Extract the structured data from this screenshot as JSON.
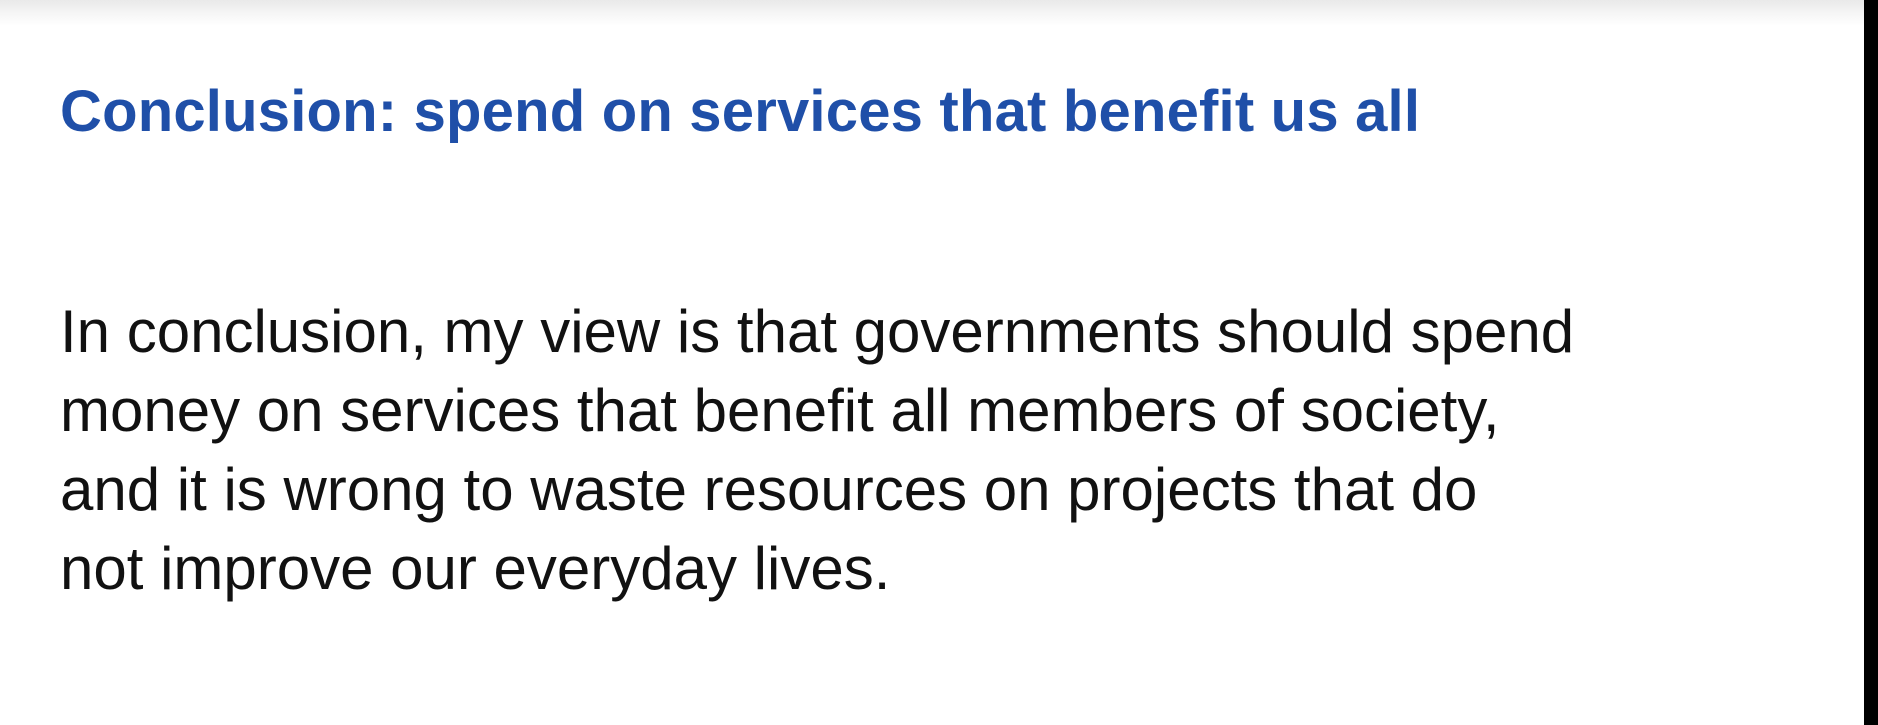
{
  "slide": {
    "title": "Conclusion: spend on services that benefit us all",
    "body_lines": [
      "In conclusion, my view is that governments should spend",
      "money on services that benefit all members of society,",
      "and it is wrong to waste resources on projects that do",
      "not improve our everyday lives."
    ]
  },
  "colors": {
    "title": "#1f4fa8",
    "body": "#111111",
    "background": "#ffffff"
  }
}
